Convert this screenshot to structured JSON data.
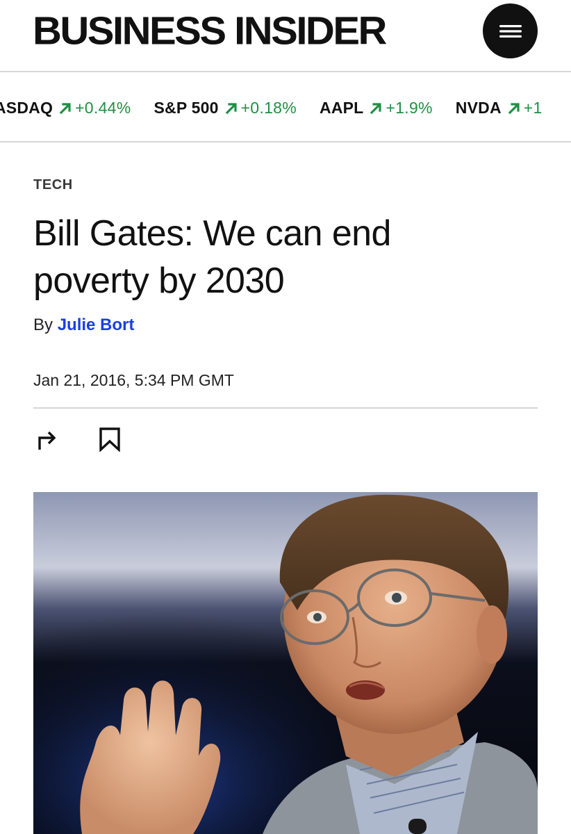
{
  "header": {
    "logo": "BUSINESS INSIDER",
    "menu_icon": "hamburger-menu-icon"
  },
  "ticker": [
    {
      "name": "ASDAQ",
      "change": "+0.44%",
      "direction": "up"
    },
    {
      "name": "S&P 500",
      "change": "+0.18%",
      "direction": "up"
    },
    {
      "name": "AAPL",
      "change": "+1.9%",
      "direction": "up"
    },
    {
      "name": "NVDA",
      "change": "+1",
      "direction": "up"
    }
  ],
  "colors": {
    "ticker_up": "#1f8f45",
    "author_link": "#1a3fe0"
  },
  "article": {
    "category": "TECH",
    "headline": "Bill Gates: We can end poverty by 2030",
    "byline_prefix": "By",
    "author": "Julie Bort",
    "date": "Jan 21, 2016, 5:34 PM GMT",
    "share_icon": "share-arrow-icon",
    "bookmark_icon": "bookmark-icon",
    "hero_image": "photo-bill-gates-speaking"
  }
}
